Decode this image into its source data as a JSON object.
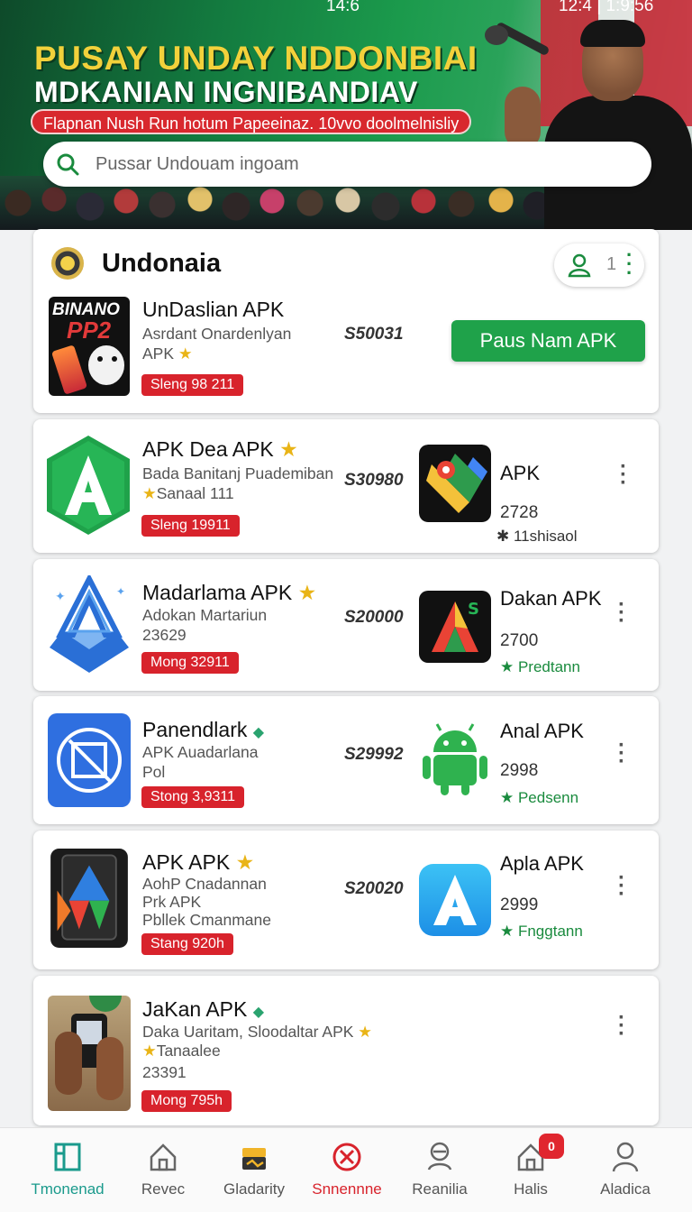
{
  "status_bar": {
    "time": "14:6",
    "right_text": "12:4 | 1:9:56"
  },
  "hero": {
    "title_line1": "PUSAY UNDAY NDDONBIAI",
    "title_line2": "MDKANIAN INGNIBANDIAV",
    "ribbon": "Flapnan Nush Run hotum Papeeinaz.  10vvo doolmelnisliy",
    "search_placeholder": "Pussar Undouam ingoam"
  },
  "header": {
    "brand": "Undonaia",
    "user_count": "1"
  },
  "featured": {
    "title": "UnDaslian APK",
    "desc_line1": "Asrdant Onardenlyan",
    "desc_line2": "APK",
    "price": "S50031",
    "pill": "Sleng 98 211",
    "cta": "Paus Nam APK",
    "icon_text": "BINANO",
    "icon_sub": "PP2"
  },
  "apps": [
    {
      "title": "APK Dea APK",
      "desc_line1": "Bada Banitanj Puademiban",
      "desc_line2": "Sanaal 111",
      "price": "S30980",
      "pill": "Sleng 19911",
      "right_title": "APK",
      "right_num": "2728",
      "right_tag": "11shisaol"
    },
    {
      "title": "Madarlama APK",
      "desc_line1": "Adokan Martariun",
      "desc_line2": "23629",
      "price": "S20000",
      "pill": "Mong 32911",
      "right_title": "Dakan APK",
      "right_num": "2700",
      "right_tag": "Predtann"
    },
    {
      "title": "Panendlark",
      "desc_line1": "APK Auadarlana",
      "desc_line2": "Pol",
      "price": "S29992",
      "pill": "Stong 3,9311",
      "right_title": "Anal APK",
      "right_num": "2998",
      "right_tag": "Pedsenn"
    },
    {
      "title": "APK APK",
      "desc_line1": "AohP Cnadannan",
      "desc_line2": "Prk APK",
      "desc_line3": "Pbllek Cmanmane",
      "price": "S20020",
      "pill": "Stang 920h",
      "right_title": "Apla APK",
      "right_num": "2999",
      "right_tag": "Fnggtann"
    },
    {
      "title": "JaKan APK",
      "desc_line1": "Daka Uaritam, Sloodaltar APK",
      "desc_line2": "Tanaalee",
      "desc_line3": "23391",
      "pill": "Mong 795h"
    }
  ],
  "bottom_nav": [
    {
      "label": "Tmonenad",
      "icon": "home-shop-icon"
    },
    {
      "label": "Revec",
      "icon": "house-icon"
    },
    {
      "label": "Gladarity",
      "icon": "toolbox-icon"
    },
    {
      "label": "Snnennne",
      "icon": "cancel-circle-icon"
    },
    {
      "label": "Reanilia",
      "icon": "search-person-icon"
    },
    {
      "label": "Halis",
      "icon": "house-badge-icon"
    },
    {
      "label": "Aladica",
      "icon": "profile-icon"
    }
  ],
  "nav_badge": "0",
  "colors": {
    "accent_green": "#1fa24a",
    "pill_red": "#d8232c",
    "active_teal": "#1a9a8c",
    "star_gold": "#e9b417"
  }
}
